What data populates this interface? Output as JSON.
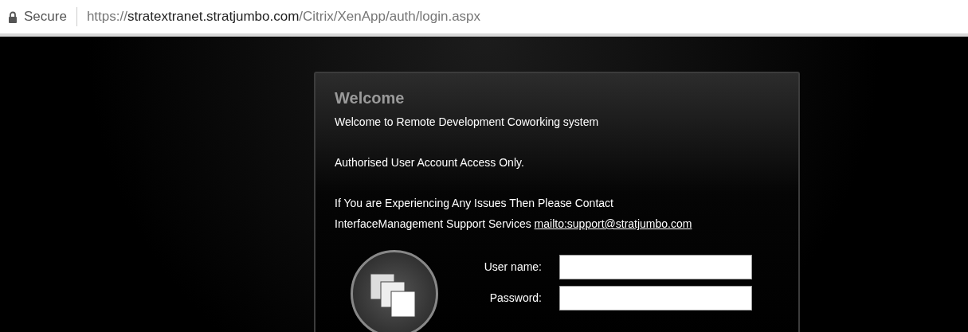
{
  "address_bar": {
    "security": "Secure",
    "url": "https://**stratextranet.stratjumbo.com**/Citrix/XenApp/auth/login.aspx"
  },
  "login": {
    "title": "Welcome",
    "paragraphs": [
      {
        "text": "Welcome to Remote Development Coworking system"
      },
      {
        "text": "Authorised User Account Access Only."
      },
      {
        "text": "If You are Experiencing Any Issues Then Please Contact InterfaceManagement Support Services",
        "link": "mailto:support@stratjumbo.com"
      }
    ],
    "fields": [
      {
        "label": "User name:"
      },
      {
        "label": "Password:"
      }
    ]
  }
}
